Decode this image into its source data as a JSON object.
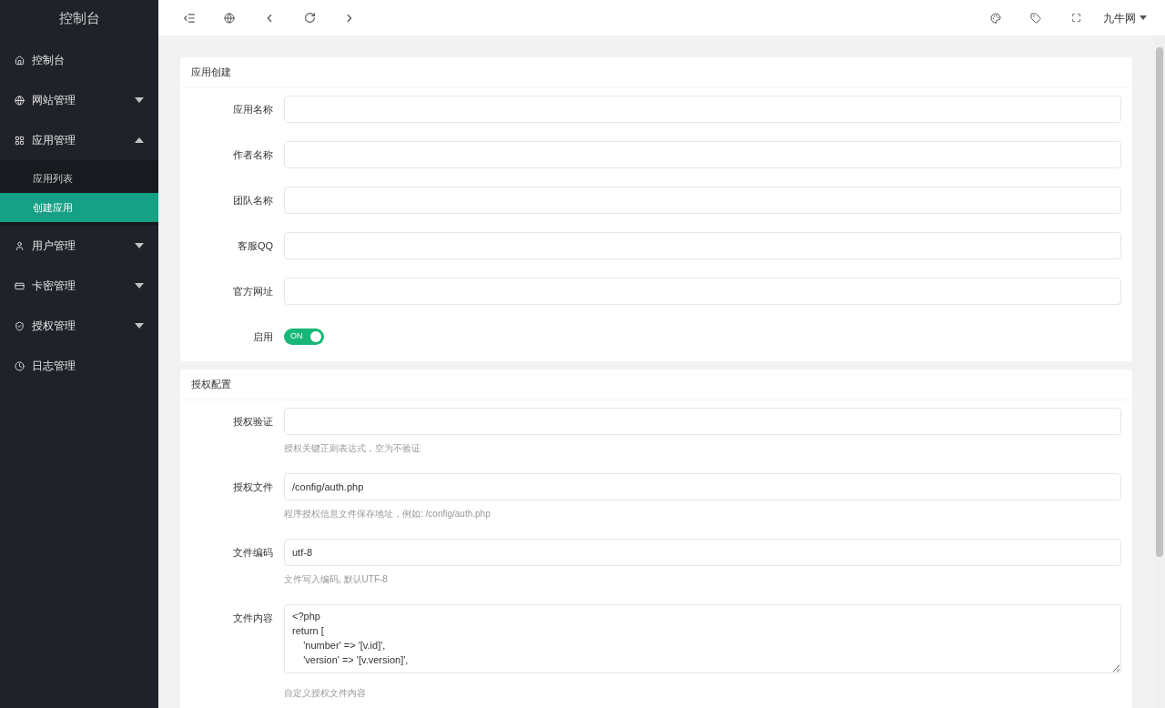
{
  "sidebar": {
    "title": "控制台",
    "items": [
      {
        "label": "控制台",
        "kind": "link"
      },
      {
        "label": "网站管理",
        "kind": "group",
        "expanded": false
      },
      {
        "label": "应用管理",
        "kind": "group",
        "expanded": true,
        "children": [
          {
            "label": "应用列表",
            "selected": false
          },
          {
            "label": "创建应用",
            "selected": true
          }
        ]
      },
      {
        "label": "用户管理",
        "kind": "group",
        "expanded": false
      },
      {
        "label": "卡密管理",
        "kind": "group",
        "expanded": false
      },
      {
        "label": "授权管理",
        "kind": "group",
        "expanded": false
      },
      {
        "label": "日志管理",
        "kind": "link"
      }
    ]
  },
  "topbar": {
    "user": "九牛网"
  },
  "sections": [
    {
      "title": "应用创建",
      "fields": [
        {
          "kind": "input",
          "label": "应用名称"
        },
        {
          "kind": "input",
          "label": "作者名称"
        },
        {
          "kind": "input",
          "label": "团队名称"
        },
        {
          "kind": "input",
          "label": "客服QQ"
        },
        {
          "kind": "input",
          "label": "官方网址"
        },
        {
          "kind": "switch",
          "label": "启用",
          "on": true,
          "text": "ON"
        }
      ]
    },
    {
      "title": "授权配置",
      "fields": [
        {
          "kind": "input",
          "label": "授权验证",
          "hint": "授权关键正则表达式，空为不验证"
        },
        {
          "kind": "input",
          "label": "授权文件",
          "value": "/config/auth.php",
          "hint": "程序授权信息文件保存地址，例如: /config/auth.php"
        },
        {
          "kind": "input",
          "label": "文件编码",
          "value": "utf-8",
          "hint": "文件写入编码, 默认UTF-8"
        },
        {
          "kind": "textarea",
          "label": "文件内容",
          "value": "<?php\nreturn [\n    'number' => '[v.id]',\n    'version' => '[v.version]',",
          "hint": "自定义授权文件内容"
        }
      ]
    }
  ]
}
